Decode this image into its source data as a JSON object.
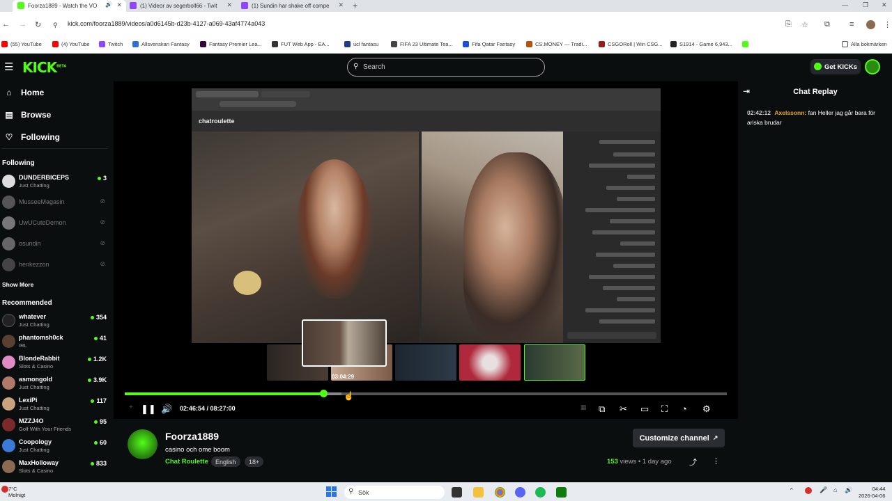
{
  "browser": {
    "tabs": [
      {
        "title": "Foorza1889 - Watch the VO",
        "color": "#53fc18",
        "active": true
      },
      {
        "title": "(1) Videor av segerboll66 - Twit",
        "color": "#9146ff",
        "active": false
      },
      {
        "title": "(1) Sundin har shake off compe",
        "color": "#9146ff",
        "active": false
      }
    ],
    "url": "kick.com/foorza1889/videos/a0d6145b-d23b-4127-a069-43af4774a043",
    "bookmarks": [
      {
        "label": "(55) YouTube",
        "color": "#ff0000"
      },
      {
        "label": "(4) YouTube",
        "color": "#ff0000"
      },
      {
        "label": "Twitch",
        "color": "#9146ff"
      },
      {
        "label": "Allsvenskan Fantasy",
        "color": "#2f6fd6"
      },
      {
        "label": "Fantasy Premier Lea...",
        "color": "#37003c"
      },
      {
        "label": "FUT Web App - EA...",
        "color": "#333333"
      },
      {
        "label": "ucl fantasu",
        "color": "#1e3a8a"
      },
      {
        "label": "FIFA 23 Ultimate Tea...",
        "color": "#444444"
      },
      {
        "label": "Fifa Qatar Fantasy",
        "color": "#1d4ed8"
      },
      {
        "label": "CS.MONEY — Tradi...",
        "color": "#b45309"
      },
      {
        "label": "CSGORoll | Win CSG...",
        "color": "#991b1b"
      },
      {
        "label": "S1914 - Game 6,943...",
        "color": "#222222"
      }
    ],
    "all_bookmarks": "Alla bokmärken"
  },
  "kick": {
    "logo": "KICK",
    "logo_sup": "BETA",
    "search_placeholder": "Search",
    "get_kicks": "Get KICKs",
    "nav": {
      "home": "Home",
      "browse": "Browse",
      "following": "Following"
    },
    "following_heading": "Following",
    "following_channels": [
      {
        "name": "DUNDERBICEPS",
        "category": "Just Chatting",
        "viewers": "3",
        "live": true,
        "color": "#dddddd"
      },
      {
        "name": "MusseeMagasin",
        "category": "",
        "viewers": "",
        "live": false,
        "color": "#555555"
      },
      {
        "name": "UwUCuteDemon",
        "category": "",
        "viewers": "",
        "live": false,
        "color": "#777777"
      },
      {
        "name": "osundin",
        "category": "",
        "viewers": "",
        "live": false,
        "color": "#666666"
      },
      {
        "name": "henkezzon",
        "category": "",
        "viewers": "",
        "live": false,
        "color": "#444444"
      }
    ],
    "show_more": "Show More",
    "recommended_heading": "Recommended",
    "recommended_channels": [
      {
        "name": "whatever",
        "category": "Just Chatting",
        "viewers": "354",
        "color": "#222222"
      },
      {
        "name": "phantomsh0ck",
        "category": "IRL",
        "viewers": "41",
        "color": "#5a4030"
      },
      {
        "name": "BlondeRabbit",
        "category": "Slots & Casino",
        "viewers": "1.2K",
        "color": "#e08bc4"
      },
      {
        "name": "asmongold",
        "category": "Just Chatting",
        "viewers": "3.9K",
        "color": "#b07a6a"
      },
      {
        "name": "LexiPi",
        "category": "Just Chatting",
        "viewers": "117",
        "color": "#c9a27e"
      },
      {
        "name": "MZZJ4O",
        "category": "Golf With Your Friends",
        "viewers": "95",
        "color": "#7a2a2a"
      },
      {
        "name": "Coopology",
        "category": "Just Chatting",
        "viewers": "60",
        "color": "#3a7bd5"
      },
      {
        "name": "MaxHolloway",
        "category": "Slots & Casino",
        "viewers": "833",
        "color": "#8a6a50"
      }
    ],
    "video": {
      "inner_brand": "chatroulette",
      "preview_time": "03:04:29",
      "current_time": "02:46:54",
      "duration": "08:27:00",
      "progress": 0.33,
      "buffered": 0.36
    },
    "channel": {
      "name": "Foorza1889",
      "title": "casino och ome boom",
      "category": "Chat Roulette",
      "tags": [
        "English",
        "18+"
      ],
      "customize": "Customize channel",
      "views_count": "153",
      "views_label": "views",
      "age": "1 day ago"
    },
    "chat": {
      "title": "Chat Replay",
      "messages": [
        {
          "time": "02:42:12",
          "user": "Axelssonn:",
          "text": "fan Heller jag går bara för ariska brudar"
        }
      ]
    }
  },
  "taskbar": {
    "temp": "7°C",
    "weather": "Molnigt",
    "search": "Sök",
    "time": "04:44",
    "date": "2026-04-06"
  }
}
